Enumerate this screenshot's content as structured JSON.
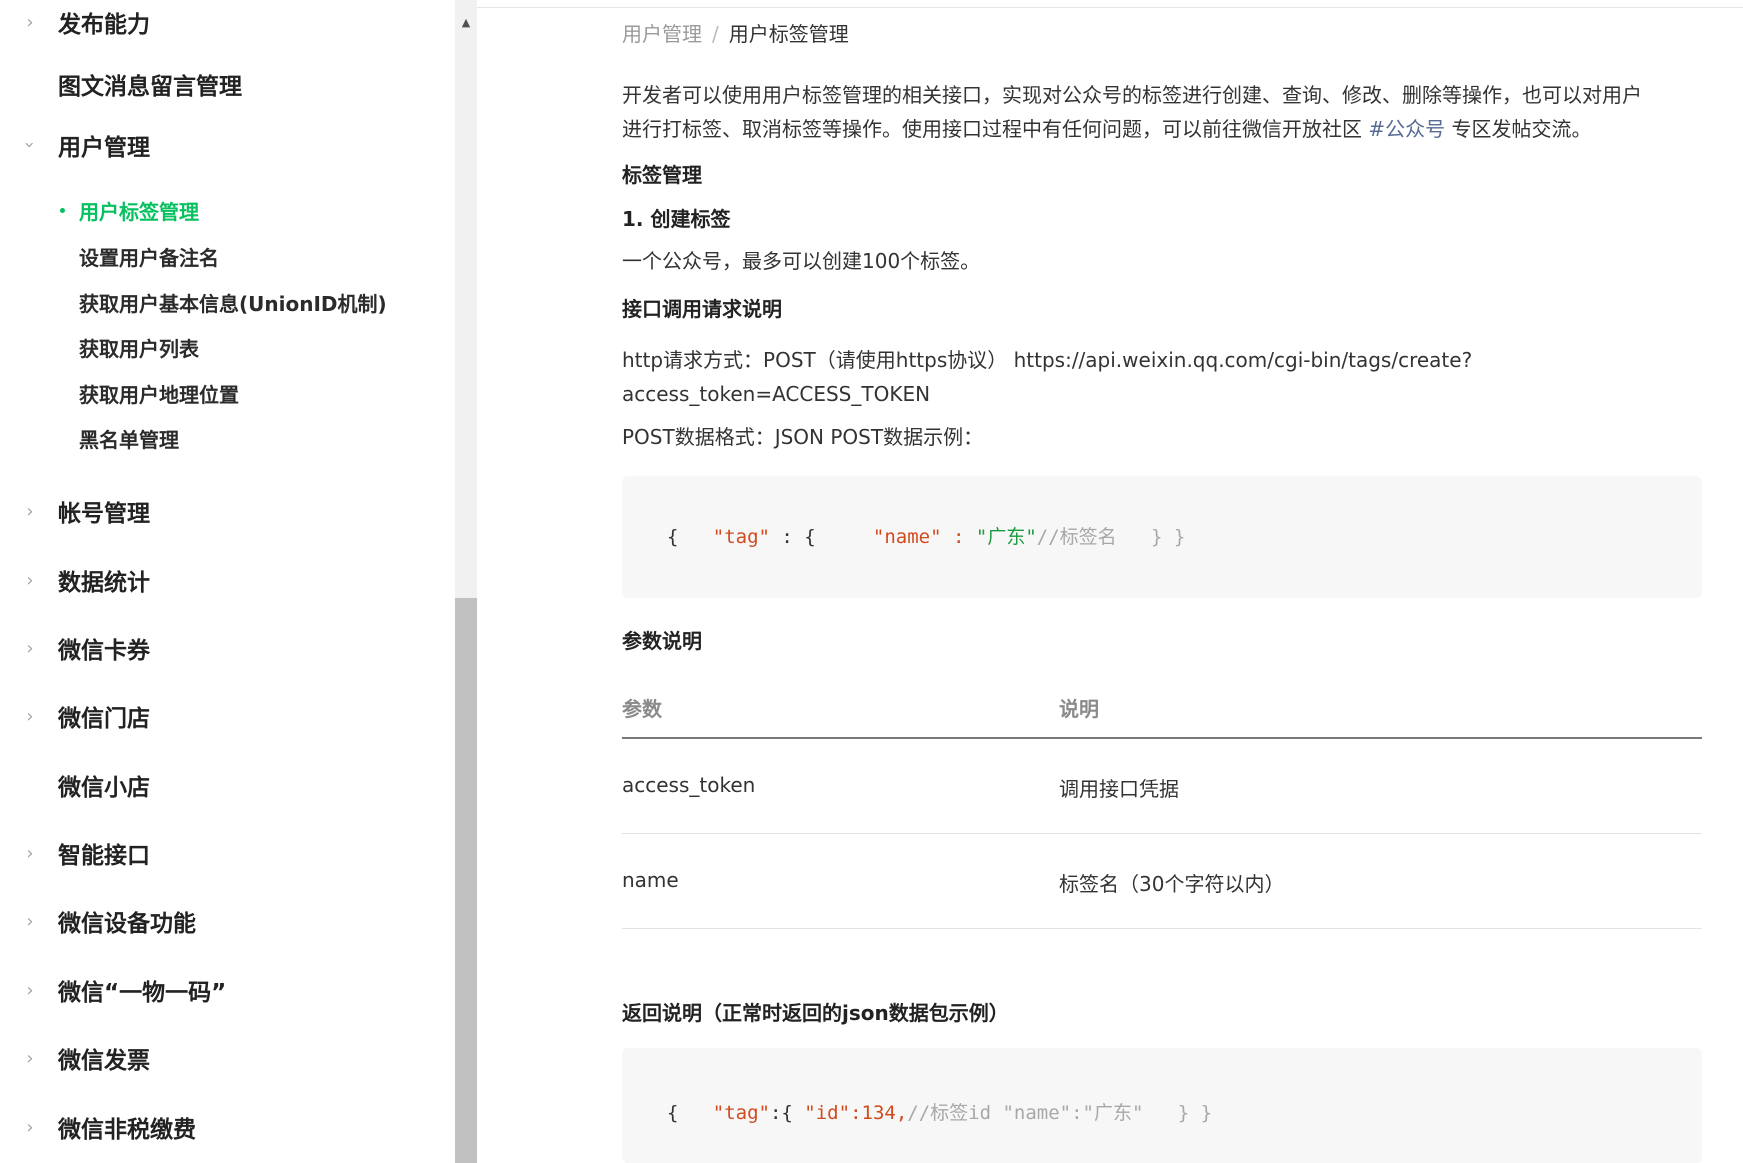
{
  "breadcrumb": {
    "parent": "用户管理",
    "separator": "/",
    "current": "用户标签管理"
  },
  "sidebar": {
    "items": [
      {
        "label": "发布能力",
        "chevron": "chevron-right-icon"
      },
      {
        "label": "图文消息留言管理",
        "chevron": ""
      },
      {
        "label": "用户管理",
        "chevron": "chevron-down-icon"
      },
      {
        "label": "帐号管理",
        "chevron": "chevron-right-icon"
      },
      {
        "label": "数据统计",
        "chevron": "chevron-right-icon"
      },
      {
        "label": "微信卡券",
        "chevron": "chevron-right-icon"
      },
      {
        "label": "微信门店",
        "chevron": "chevron-right-icon"
      },
      {
        "label": "微信小店",
        "chevron": ""
      },
      {
        "label": "智能接口",
        "chevron": "chevron-right-icon"
      },
      {
        "label": "微信设备功能",
        "chevron": "chevron-right-icon"
      },
      {
        "label": "微信“一物一码”",
        "chevron": "chevron-right-icon"
      },
      {
        "label": "微信发票",
        "chevron": "chevron-right-icon"
      },
      {
        "label": "微信非税缴费",
        "chevron": "chevron-right-icon"
      }
    ],
    "subitems": [
      {
        "label": "用户标签管理",
        "active": true
      },
      {
        "label": "设置用户备注名",
        "active": false
      },
      {
        "label": "获取用户基本信息(UnionID机制)",
        "active": false
      },
      {
        "label": "获取用户列表",
        "active": false
      },
      {
        "label": "获取用户地理位置",
        "active": false
      },
      {
        "label": "黑名单管理",
        "active": false
      }
    ]
  },
  "content": {
    "intro_line1": "开发者可以使用用户标签管理的相关接口，实现对公众号的标签进行创建、查询、修改、删除等操作，也可以对用户",
    "intro_line2_a": "进行打标签、取消标签等操作。使用接口过程中有任何问题，可以前往微信开放社区 ",
    "intro_link": "#公众号",
    "intro_line2_b": " 专区发帖交流。",
    "section_title": "标签管理",
    "step_title": "1. 创建标签",
    "step_desc": "一个公众号，最多可以创建100个标签。",
    "api_title": "接口调用请求说明",
    "http_line1": "http请求方式：POST（请使用https协议） https://api.weixin.qq.com/cgi-bin/tags/create?",
    "http_line2": "access_token=ACCESS_TOKEN",
    "post_format": "POST数据格式：JSON POST数据示例：",
    "code1": {
      "open": "{   ",
      "key_tag": "\"tag\"",
      "colon_brace": " : {     ",
      "key_name": "\"name\"",
      "colon": " : ",
      "val": "\"广东\"",
      "comment": "//标签名",
      "close": "   } }"
    },
    "params_title": "参数说明",
    "table": {
      "headers": [
        "参数",
        "说明"
      ],
      "rows": [
        [
          "access_token",
          "调用接口凭据"
        ],
        [
          "name",
          "标签名（30个字符以内）"
        ]
      ]
    },
    "return_title": "返回说明（正常时返回的json数据包示例）",
    "code2": {
      "open": "{   ",
      "key_tag": "\"tag\"",
      "colon_brace": ":{ ",
      "key_id": "\"id\"",
      "num": ":134,",
      "comment": "//标签id \"name\":\"广东\"",
      "close": "   } }"
    }
  },
  "colors": {
    "accent": "#07c160",
    "link": "#576b95",
    "code_key": "#d14b1f",
    "code_string": "#1c9a3e",
    "code_comment": "#a8a8a8"
  }
}
